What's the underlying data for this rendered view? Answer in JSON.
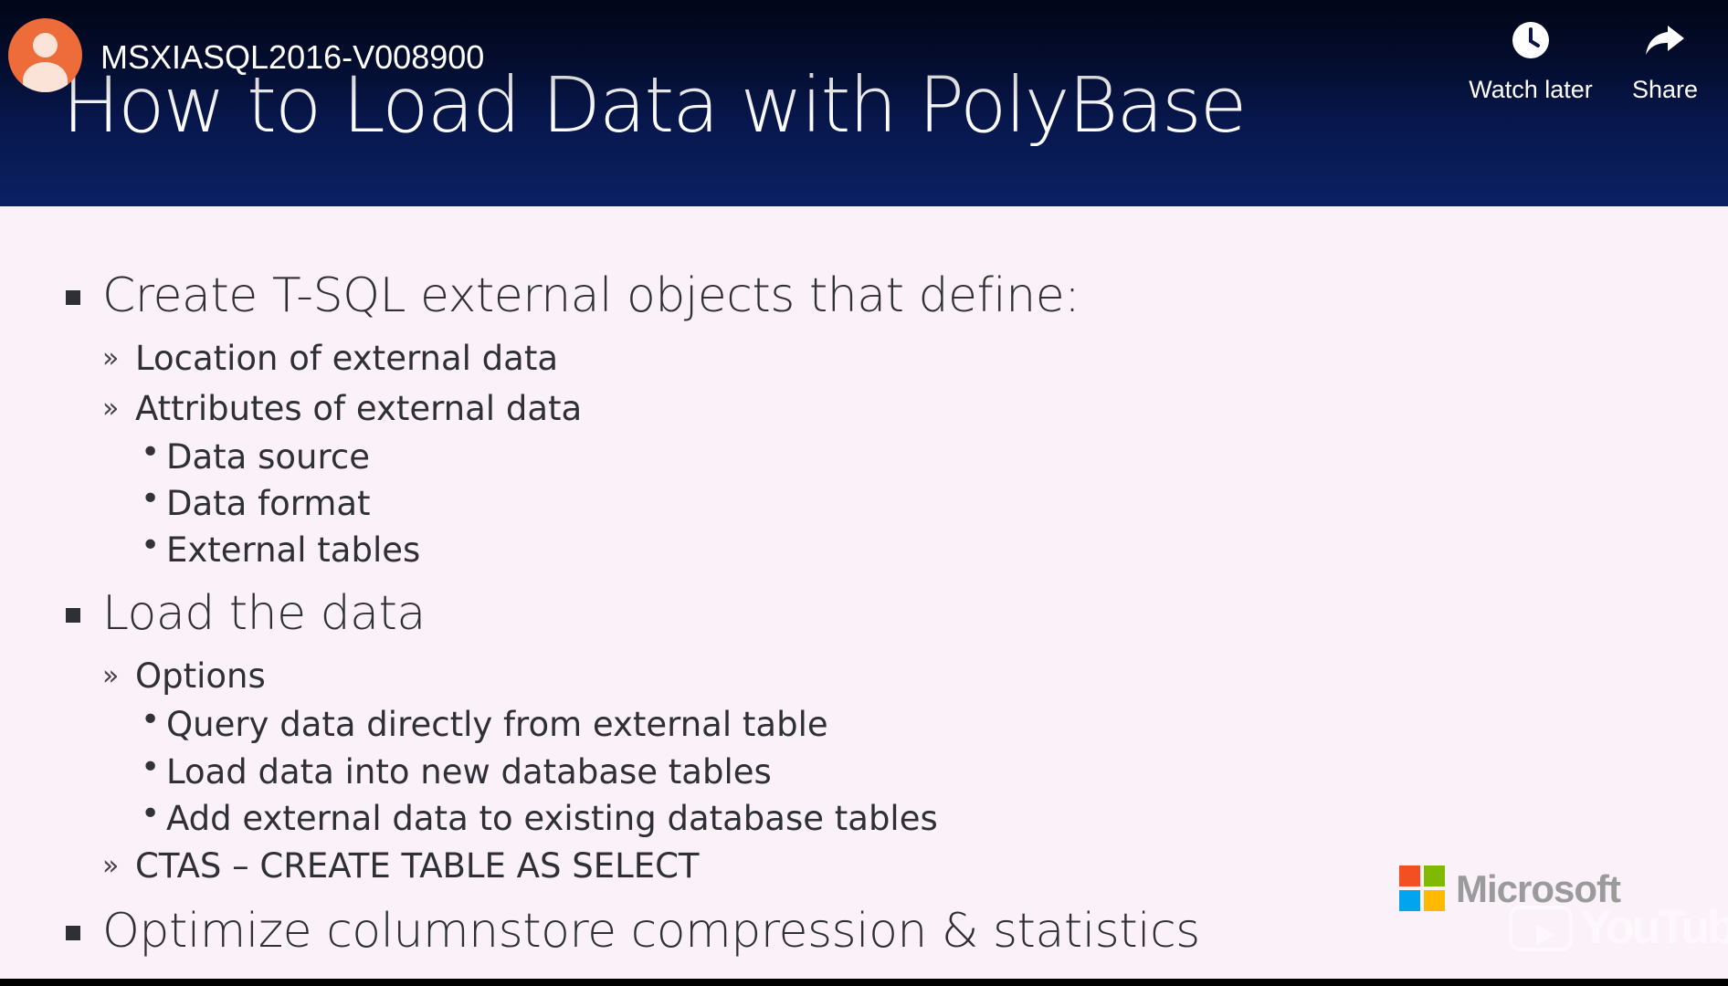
{
  "channel": {
    "avatar_icon": "default-user-avatar-icon",
    "avatar_color": "#ee6b3a",
    "title": "MSXIASQL2016-V008900"
  },
  "actions": {
    "watch_later": {
      "label": "Watch later",
      "icon": "clock-icon"
    },
    "share": {
      "label": "Share",
      "icon": "share-arrow-icon"
    }
  },
  "slide": {
    "title": "How to Load Data with PolyBase",
    "header_color": "#07164a",
    "body_color": "#fbf1f9",
    "bullets": [
      {
        "level": 1,
        "text": "Create T-SQL external objects that define:"
      },
      {
        "level": 2,
        "text": "Location of external data"
      },
      {
        "level": 2,
        "text": "Attributes of external data"
      },
      {
        "level": 3,
        "text": "Data source"
      },
      {
        "level": 3,
        "text": "Data format"
      },
      {
        "level": 3,
        "text": "External tables"
      },
      {
        "level": 1,
        "text": "Load the data"
      },
      {
        "level": 2,
        "text": "Options"
      },
      {
        "level": 3,
        "text": "Query data directly from external table"
      },
      {
        "level": 3,
        "text": "Load data into new database tables"
      },
      {
        "level": 3,
        "text": "Add external data to existing database tables"
      },
      {
        "level": 2,
        "text": "CTAS – CREATE TABLE AS SELECT"
      },
      {
        "level": 1,
        "text": "Optimize columnstore compression & statistics"
      }
    ],
    "branding": {
      "company": "Microsoft",
      "logo_colors": [
        "#f25022",
        "#7fba00",
        "#00a4ef",
        "#ffb900"
      ]
    }
  },
  "watermark": {
    "text": "YouTube",
    "icon": "youtube-play-icon"
  }
}
